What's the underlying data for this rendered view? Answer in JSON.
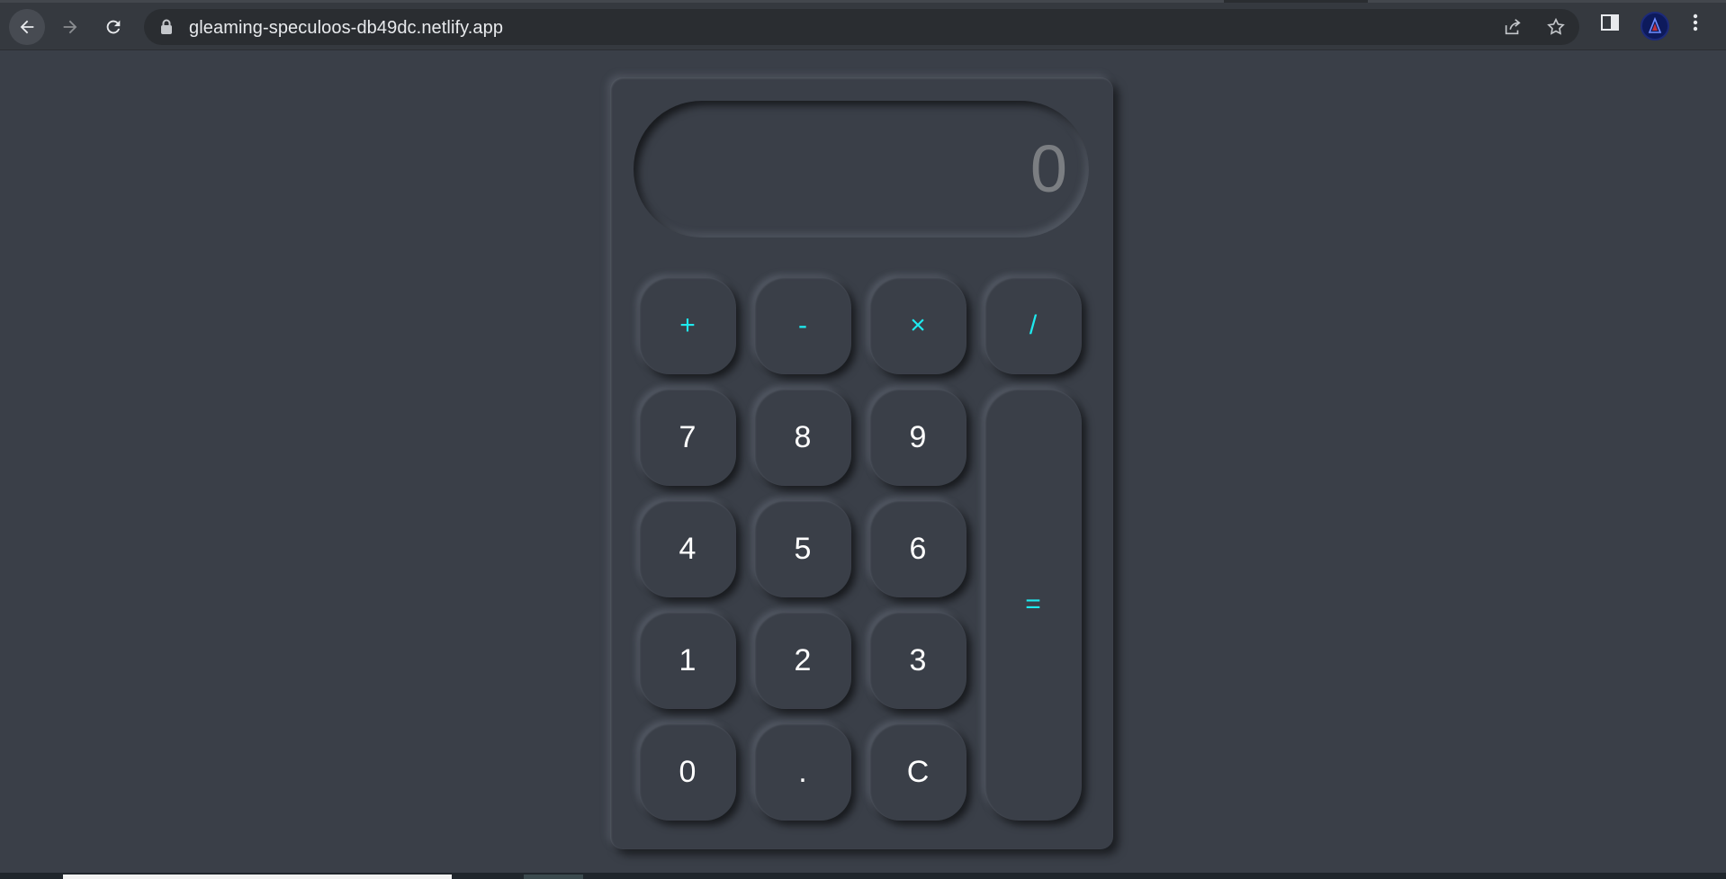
{
  "browser": {
    "url": "gleaming-speculoos-db49dc.netlify.app",
    "icons": {
      "back": "arrow-left-icon",
      "forward": "arrow-right-icon",
      "reload": "reload-icon",
      "lock": "lock-icon",
      "share": "share-icon",
      "bookmark": "star-icon",
      "side_panel": "side-panel-icon",
      "profile": "avatar",
      "menu": "kebab-menu-icon"
    }
  },
  "calculator": {
    "display": "0",
    "operators": [
      "+",
      "-",
      "×",
      "/"
    ],
    "row1": [
      "7",
      "8",
      "9"
    ],
    "row2": [
      "4",
      "5",
      "6"
    ],
    "row3": [
      "1",
      "2",
      "3"
    ],
    "row4": [
      "0",
      ".",
      "C"
    ],
    "equals": "=",
    "colors": {
      "background": "#3a3f48",
      "operator_text": "#1ee9ee",
      "digit_text": "#ffffff",
      "display_text": "#7b7e82"
    }
  }
}
